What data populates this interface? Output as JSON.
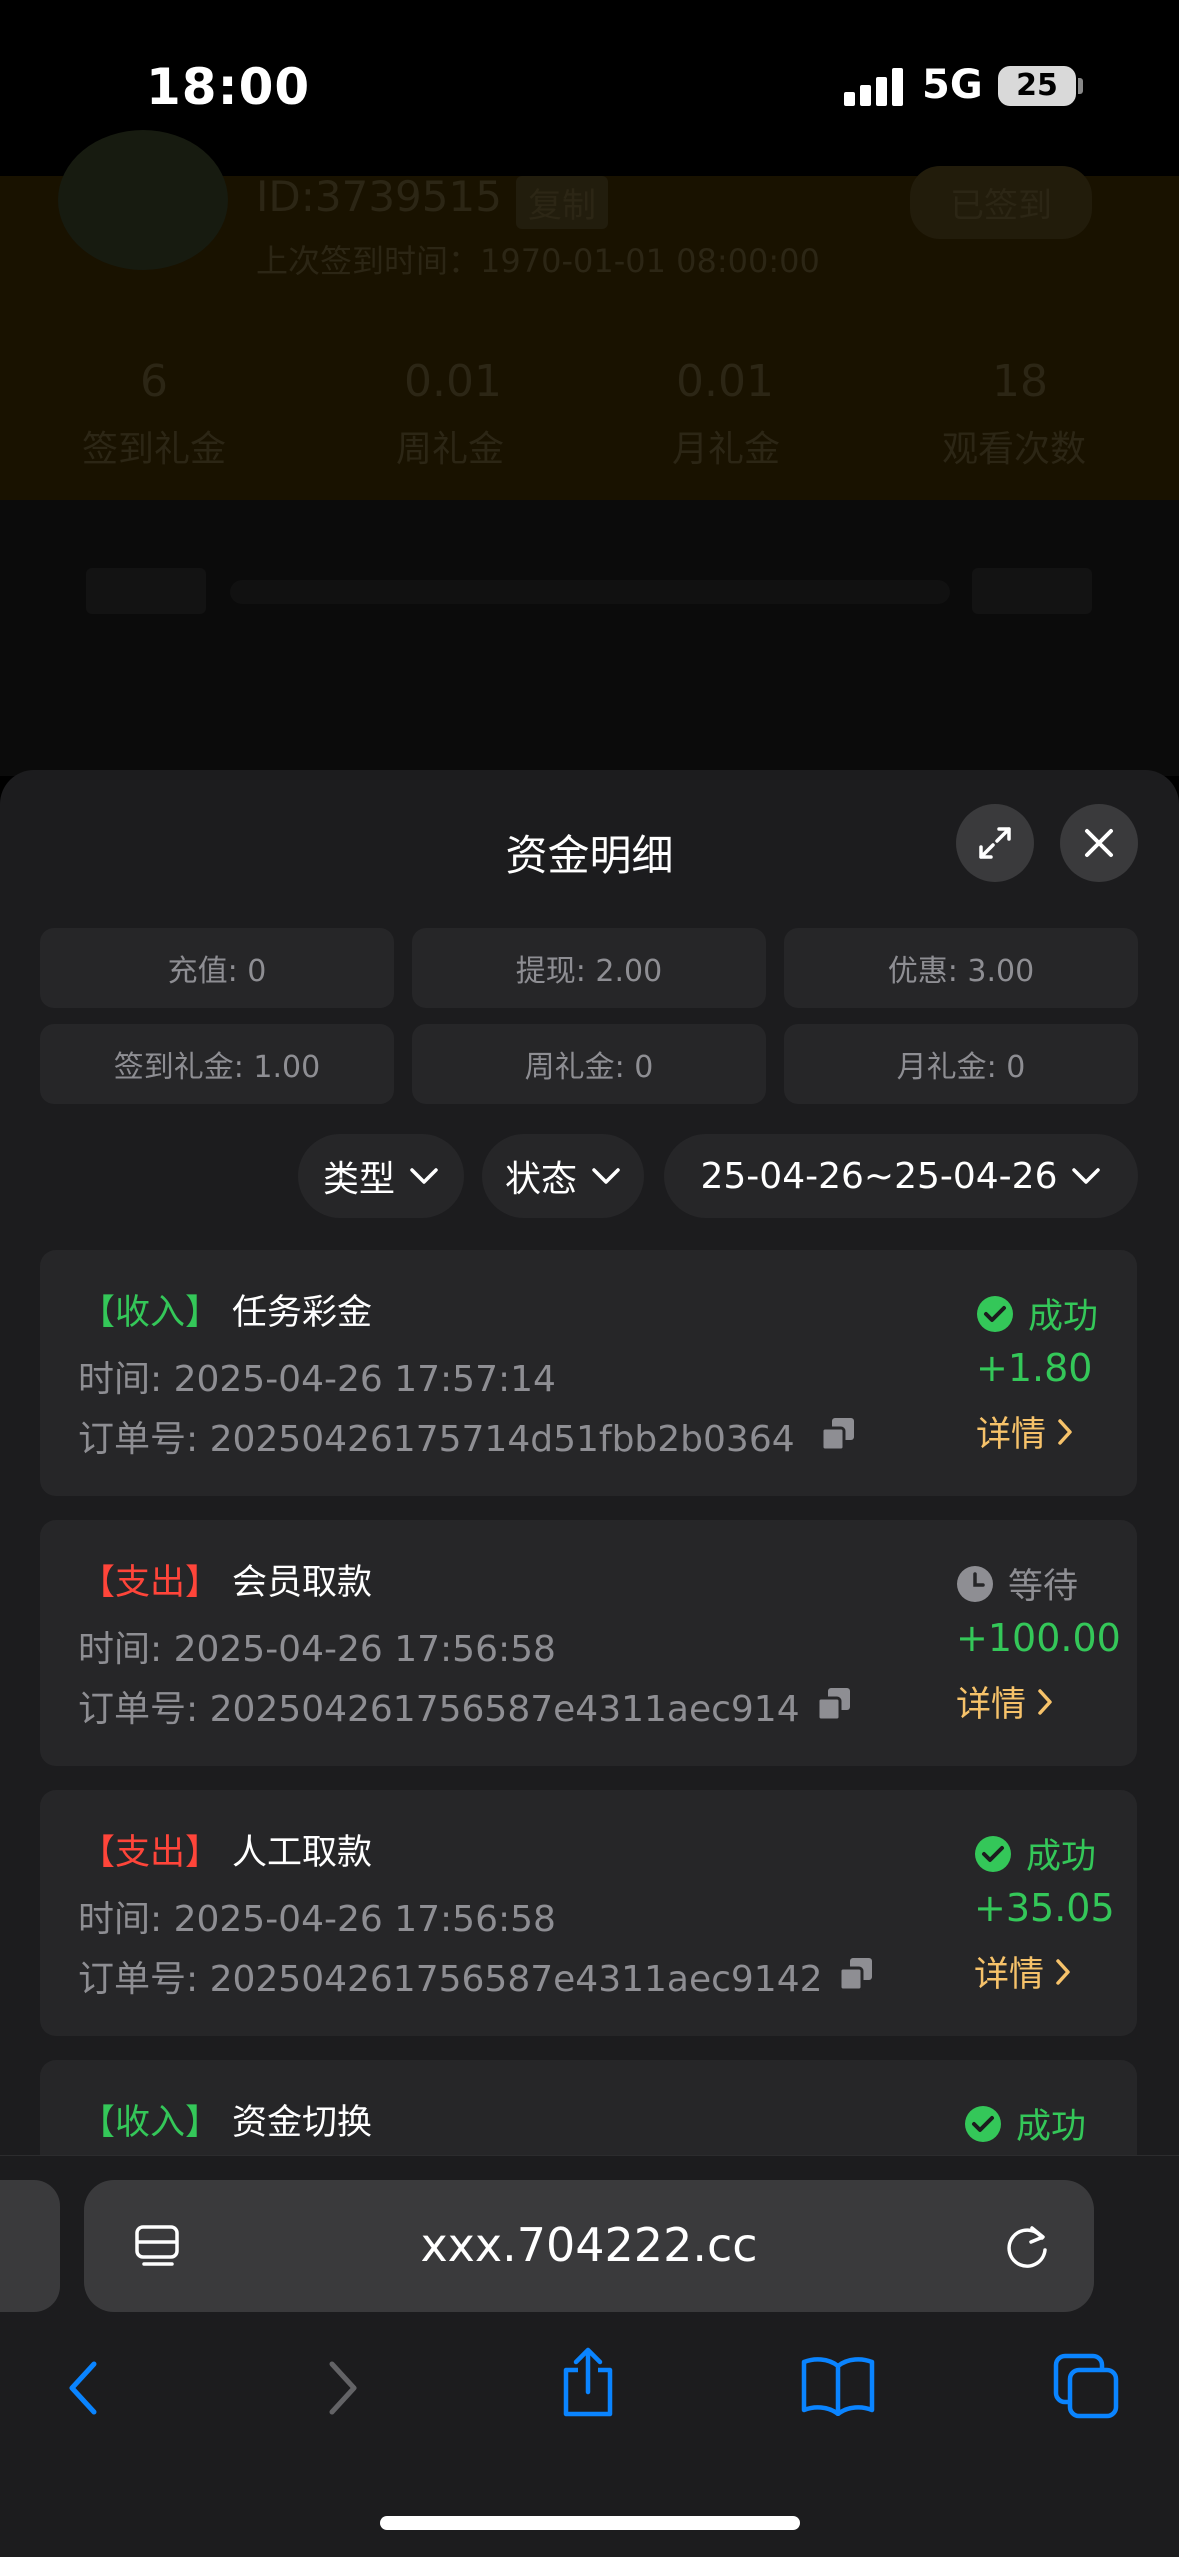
{
  "status_bar": {
    "time": "18:00",
    "network": "5G",
    "battery": "25"
  },
  "background": {
    "user_id": "ID:3739515",
    "copy_label": "复制",
    "signin_label": "已签到",
    "last_time": "上次签到时间：1970-01-01 08:00:00",
    "stats": [
      {
        "value": "6",
        "label": "签到礼金"
      },
      {
        "value": "0.01",
        "label": "周礼金"
      },
      {
        "value": "0.01",
        "label": "月礼金"
      },
      {
        "value": "18",
        "label": "观看次数"
      }
    ]
  },
  "sheet": {
    "title": "资金明细",
    "stats": [
      "充值: 0",
      "提现: 2.00",
      "优惠: 3.00",
      "签到礼金: 1.00",
      "周礼金: 0",
      "月礼金: 0"
    ],
    "filters": {
      "type": "类型",
      "status": "状态",
      "date_range": "25-04-26~25-04-26"
    },
    "records": [
      {
        "tag": "【收入】",
        "kind": "income",
        "category": "任务彩金",
        "time": "时间:  2025-04-26 17:57:14",
        "order": "订单号: 20250426175714d51fbb2b0364",
        "status": "成功",
        "status_kind": "success",
        "amount": "+1.80",
        "detail": "详情"
      },
      {
        "tag": "【支出】",
        "kind": "expense",
        "category": "会员取款",
        "time": "时间:  2025-04-26 17:56:58",
        "order": "订单号: 202504261756587e4311aec914",
        "status": "等待",
        "status_kind": "pending",
        "amount": "+100.00",
        "detail": "详情"
      },
      {
        "tag": "【支出】",
        "kind": "expense",
        "category": "人工取款",
        "time": "时间:  2025-04-26 17:56:58",
        "order": "订单号: 202504261756587e4311aec9142",
        "status": "成功",
        "status_kind": "success",
        "amount": "+35.05",
        "detail": "详情"
      },
      {
        "tag": "【收入】",
        "kind": "income",
        "category": "资金切换",
        "status": "成功",
        "status_kind": "success"
      }
    ]
  },
  "browser": {
    "url": "xxx.704222.cc"
  },
  "colors": {
    "success": "#34c759",
    "expense": "#ff453a",
    "detail": "#f6c26a",
    "ios_blue": "#0a84ff"
  }
}
